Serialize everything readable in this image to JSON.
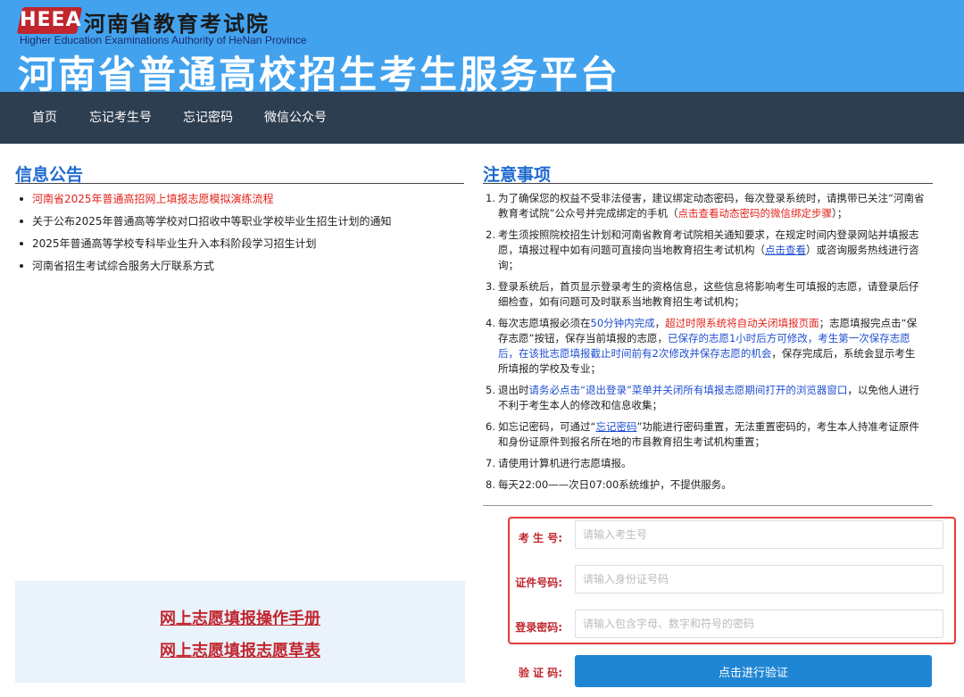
{
  "header": {
    "logo_text": "HEEA",
    "org_name_cn": "河南省教育考试院",
    "org_name_en": "Higher Education Examinations Authority of HeNan Province",
    "platform_title": "河南省普通高校招生考生服务平台"
  },
  "nav": {
    "items": [
      "首页",
      "忘记考生号",
      "忘记密码",
      "微信公众号"
    ]
  },
  "announcements": {
    "title": "信息公告",
    "items": [
      "河南省2025年普通高招网上填报志愿模拟演练流程",
      "关于公布2025年普通高等学校对口招收中等职业学校毕业生招生计划的通知",
      "2025年普通高等学校专科毕业生升入本科阶段学习招生计划",
      "河南省招生考试综合服务大厅联系方式"
    ]
  },
  "manuals": {
    "operation_manual": "网上志愿填报操作手册",
    "draft_form": "网上志愿填报志愿草表"
  },
  "notes": {
    "title": "注意事项",
    "n1": {
      "num": "1.",
      "a": "为了确保您的权益不受非法侵害，建议绑定动态密码，每次登录系统时，请携带已关注“河南省教育考试院”公众号并完成绑定的手机（",
      "red": "点击查看动态密码的微信绑定步骤",
      "b": "）；"
    },
    "n2": {
      "num": "2.",
      "a": "考生须按照院校招生计划和河南省教育考试院相关通知要求，在规定时间内登录网站并填报志愿，填报过程中如有问题可直接向当地教育招生考试机构（",
      "link": "点击查看",
      "b": "）或咨询服务热线进行咨询；"
    },
    "n3": {
      "num": "3.",
      "a": "登录系统后，首页显示登录考生的资格信息，这些信息将影响考生可填报的志愿，请登录后仔细检查，如有问题可及时联系当地教育招生考试机构；"
    },
    "n4": {
      "num": "4.",
      "a": "每次志愿填报必须在",
      "blue1": "50分钟内完成",
      "sep": "，",
      "red": "超过时限系统将自动关闭填报页面",
      "b": "；志愿填报完点击“保存志愿”按钮，保存当前填报的志愿，",
      "blue2": "已保存的志愿1小时后方可修改，考生第一次保存志愿后，在该批志愿填报截止时间前有2次修改并保存志愿的机会",
      "c": "，保存完成后，系统会显示考生所填报的学校及专业；"
    },
    "n5": {
      "num": "5.",
      "a": "退出时",
      "blue": "请务必点击“退出登录”菜单并关闭所有填报志愿期间打开的浏览器窗口",
      "b": "，以免他人进行不利于考生本人的修改和信息收集；"
    },
    "n6": {
      "num": "6.",
      "a": "如忘记密码，可通过“",
      "link": "忘记密码",
      "b": "”功能进行密码重置，无法重置密码的，考生本人持准考证原件和身份证原件到报名所在地的市县教育招生考试机构重置；"
    },
    "n7": {
      "num": "7.",
      "a": "请使用计算机进行志愿填报。"
    },
    "n8": {
      "num": "8.",
      "a": "每天22:00——次日07:00系统维护，不提供服务。"
    }
  },
  "login": {
    "exam_no_label": "考 生 号:",
    "exam_no_placeholder": "请输入考生号",
    "id_label": "证件号码:",
    "id_placeholder": "请输入身份证号码",
    "password_label": "登录密码:",
    "password_placeholder": "请输入包含字母、数字和符号的密码",
    "captcha_label": "验 证 码:",
    "verify_button": "点击进行验证"
  },
  "colors": {
    "header_bg": "#42a2ee",
    "nav_bg": "#2d3e50",
    "title_blue": "#1f6ad1",
    "accent_red": "#e2231a",
    "button_blue": "#1f86d4"
  }
}
